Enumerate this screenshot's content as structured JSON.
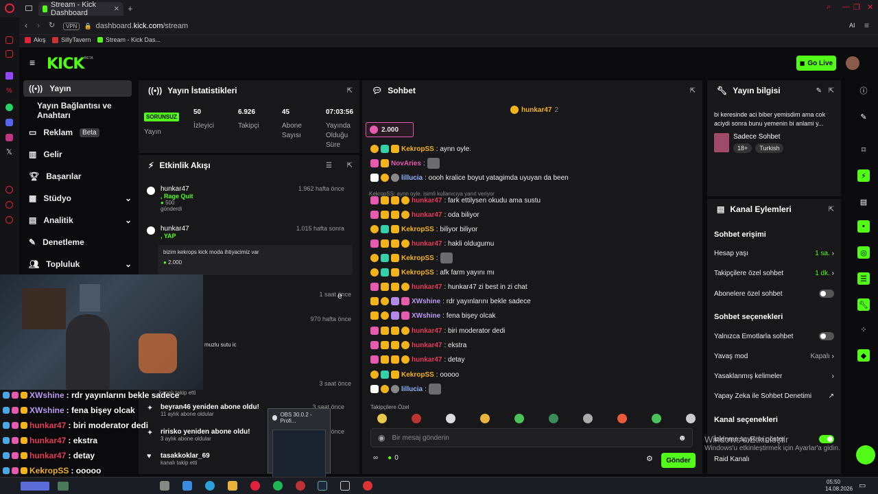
{
  "browser": {
    "tab_title": "Stream - Kick Dashboard",
    "url_domain": "dashboard.",
    "url_host": "kick.com",
    "url_path": "/stream",
    "vpn": "VPN",
    "bookmarks": [
      "Akış",
      "SillyTavern",
      "Stream - Kick Das..."
    ],
    "ai_label": "AI"
  },
  "header": {
    "logo": "KICK",
    "beta": "BETA",
    "go_live": "Go Live"
  },
  "nav": {
    "items": [
      {
        "label": "Yayın"
      },
      {
        "label": "Yayın Bağlantısı ve Anahtarı"
      },
      {
        "label": "Reklam",
        "badge": "Beta"
      },
      {
        "label": "Gelir"
      },
      {
        "label": "Başarılar"
      },
      {
        "label": "Stüdyo"
      },
      {
        "label": "Analitik"
      },
      {
        "label": "Denetleme"
      },
      {
        "label": "Topluluk"
      }
    ]
  },
  "stats": {
    "title": "Yayın İstatistikleri",
    "status": "SORUNSUZ",
    "status_label": "Yayın",
    "cells": [
      {
        "value": "50",
        "label": "İzleyici"
      },
      {
        "value": "6.926",
        "label": "Takipçi"
      },
      {
        "value": "45",
        "label": "Abone Sayısı"
      },
      {
        "value": "07:03:56",
        "label": "Yayında Olduğu Süre"
      }
    ]
  },
  "activity": {
    "title": "Etkinlik Akışı",
    "events": [
      {
        "name": "hunkar47",
        "sub": ", Rage Quit",
        "amount": "500",
        "detail": "gönderdi",
        "time": "1.962 hafta önce"
      },
      {
        "name": "hunkar47",
        "sub": ", YAP",
        "message": "bizim kekrops kick moda ihtiyacimiz var",
        "amount": "2.000",
        "time": "1.015 hafta sonra"
      },
      {
        "name": "e",
        "time": "1 saat önce"
      },
      {
        "name": "",
        "time": "970 hafta önce",
        "message": "muzlu sutu ic"
      },
      {
        "name": "",
        "detail": "kanalı takip etti",
        "time": "3 saat önce"
      },
      {
        "name": "beyran46 yeniden abone oldu!",
        "detail": "11 aylık abone oldular",
        "time": "3 saat önce"
      },
      {
        "name": "ririsko yeniden abone oldu!",
        "detail": "3 aylık abone oldular",
        "time": "3 saat önce"
      },
      {
        "name": "tasakkoklar_69",
        "detail": "kanalı takip etti",
        "time": ""
      }
    ]
  },
  "chat": {
    "title": "Sohbet",
    "pinned_user": "hunkar47",
    "pinned_count": "2",
    "goal": "2.000",
    "reply_hint": "KekropSS: aynn oyle. isimli kullanıcıya yanıt veriyor",
    "messages": [
      {
        "user": "KekropSS",
        "cls": "u-gold",
        "text": ": aynn oyle.",
        "badges": [
          "b-gold",
          "b-teal",
          "b-kick"
        ]
      },
      {
        "user": "NovAries",
        "cls": "u-pink",
        "text": ":",
        "badges": [
          "b-pink",
          "b-kick"
        ],
        "emote": true
      },
      {
        "user": "lillucia",
        "cls": "u-blue",
        "text": ": oooh kralice boyut yatagimda uyuyan da been",
        "badges": [
          "b-white",
          "b-gold",
          "b-gray"
        ]
      },
      {
        "user": "hunkar47",
        "cls": "u-red",
        "text": ": fark ettilysen okudu ama sustu",
        "badges": [
          "b-pink",
          "b-kick",
          "b-kick",
          "b-gold"
        ]
      },
      {
        "user": "hunkar47",
        "cls": "u-red",
        "text": ": oda biliyor",
        "badges": [
          "b-pink",
          "b-kick",
          "b-kick",
          "b-gold"
        ]
      },
      {
        "user": "KekropSS",
        "cls": "u-gold",
        "text": ": biliyor biliyor",
        "badges": [
          "b-gold",
          "b-teal",
          "b-kick"
        ]
      },
      {
        "user": "hunkar47",
        "cls": "u-red",
        "text": ": hakli oldugumu",
        "badges": [
          "b-pink",
          "b-kick",
          "b-kick",
          "b-gold"
        ]
      },
      {
        "user": "KekropSS",
        "cls": "u-gold",
        "text": ":",
        "badges": [
          "b-gold",
          "b-teal",
          "b-kick"
        ],
        "emote": true
      },
      {
        "user": "KekropSS",
        "cls": "u-gold",
        "text": ": afk farm yayını mı",
        "badges": [
          "b-gold",
          "b-teal",
          "b-kick"
        ]
      },
      {
        "user": "hunkar47",
        "cls": "u-red",
        "text": ": hunkar47 zi best in zi chat",
        "badges": [
          "b-pink",
          "b-kick",
          "b-kick",
          "b-gold"
        ]
      },
      {
        "user": "XWshine",
        "cls": "u-purple",
        "text": ": rdr yayınlarını bekle sadece",
        "badges": [
          "b-kick",
          "b-gold",
          "b-purple",
          "b-pink"
        ]
      },
      {
        "user": "XWshine",
        "cls": "u-purple",
        "text": ": fena bişey olcak",
        "badges": [
          "b-kick",
          "b-gold",
          "b-purple",
          "b-pink"
        ]
      },
      {
        "user": "hunkar47",
        "cls": "u-red",
        "text": ": biri moderator dedi",
        "badges": [
          "b-pink",
          "b-kick",
          "b-kick",
          "b-gold"
        ]
      },
      {
        "user": "hunkar47",
        "cls": "u-red",
        "text": ": ekstra",
        "badges": [
          "b-pink",
          "b-kick",
          "b-kick",
          "b-gold"
        ]
      },
      {
        "user": "hunkar47",
        "cls": "u-red",
        "text": ": detay",
        "badges": [
          "b-pink",
          "b-kick",
          "b-kick",
          "b-gold"
        ]
      },
      {
        "user": "KekropSS",
        "cls": "u-gold",
        "text": ": ooooo",
        "badges": [
          "b-gold",
          "b-teal",
          "b-kick"
        ]
      },
      {
        "user": "lillucia",
        "cls": "u-blue",
        "text": ":",
        "badges": [
          "b-white",
          "b-gold",
          "b-gray"
        ],
        "emote": true
      }
    ],
    "emote_tab": "Takipçilere Özel",
    "input_placeholder": "Bir mesaj gönderin",
    "points": "0",
    "send": "Gönder"
  },
  "stream_info": {
    "title": "Yayın bilgisi",
    "stream_title": "bi keresinde aci biber yemisdim ama cok aciydi sonra bunu yemenin bi anlami y...",
    "category": "Sadece Sohbet",
    "tags": [
      "18+",
      "Turkish"
    ]
  },
  "channel_actions": {
    "title": "Kanal Eylemleri",
    "chat_access": "Sohbet erişimi",
    "account_age": "Hesap yaşı",
    "account_age_val": "1 sa.",
    "followers_only": "Takipçilere özel sohbet",
    "followers_only_val": "1 dk.",
    "subs_only": "Abonelere özel sohbet",
    "chat_options": "Sohbet seçenekleri",
    "emote_only": "Yalnızca Emotlarla sohbet",
    "slow_mode": "Yavaş mod",
    "slow_mode_val": "Kapalı",
    "banned_words": "Yasaklanmış kelimeler",
    "ai_mod": "Yapay Zeka ile Sohbet Denetimi",
    "channel_options": "Kanal seçenekleri",
    "show_viewers": "İzlenme sayısını göster",
    "raid": "Raid Kanalı"
  },
  "overlay": {
    "lines": [
      {
        "user": "XWshine",
        "cls": "u-purple",
        "text": ": rdr yayınlarını bekle sadece"
      },
      {
        "user": "XWshine",
        "cls": "u-purple",
        "text": ": fena bişey olcak"
      },
      {
        "user": "hunkar47",
        "cls": "u-red",
        "text": ": biri moderator dedi"
      },
      {
        "user": "hunkar47",
        "cls": "u-red",
        "text": ": ekstra"
      },
      {
        "user": "hunkar47",
        "cls": "u-red",
        "text": ": detay"
      },
      {
        "user": "KekropSS",
        "cls": "u-gold",
        "text": ": ooooo"
      }
    ]
  },
  "windows": {
    "activate_1": "Windows'u Etkinleştir",
    "activate_2": "Windows'u etkinleştirmek için Ayarlar'a gidin.",
    "obs": "OBS 30.0.2 - Profi...",
    "time": "05:50",
    "date": "14.08.2026"
  },
  "colors": {
    "accent": "#53fc18",
    "panel": "#18181b",
    "bg": "#0b0b0d"
  }
}
